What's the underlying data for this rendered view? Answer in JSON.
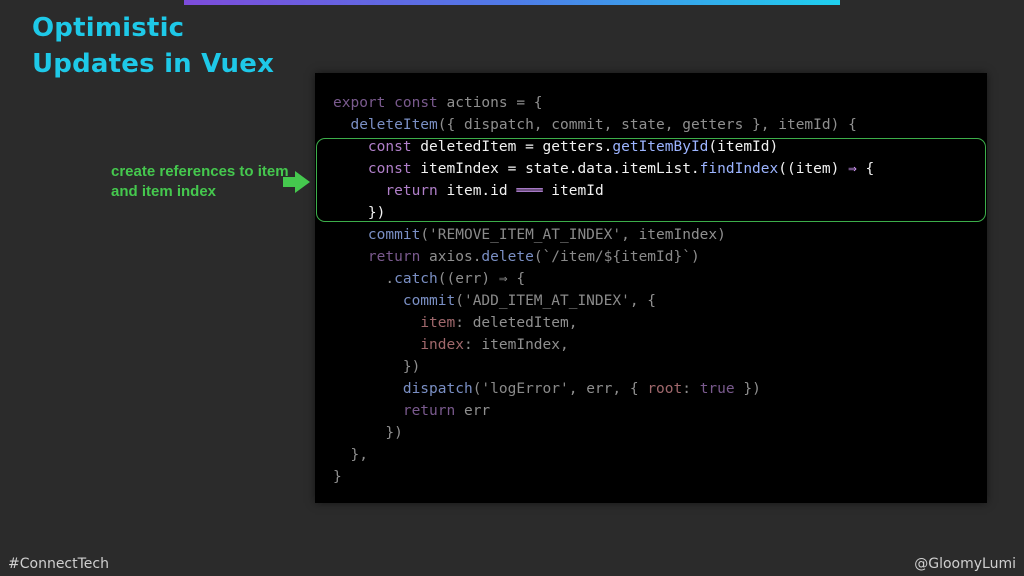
{
  "slide": {
    "title_line1": "Optimistic",
    "title_line2": "Updates in Vuex",
    "annotation": "create references to item and item index",
    "footer_left": "#ConnectTech",
    "footer_right": "@GloomyLumi"
  },
  "colors": {
    "background": "#2b2b2b",
    "title": "#1ec9e8",
    "annotation": "#45c84e",
    "highlight_border": "#3cae4a",
    "code_background": "#000000"
  },
  "icons": [
    "right-arrow-icon"
  ],
  "code": {
    "lines": [
      "export const actions = {",
      "  deleteItem({ dispatch, commit, state, getters }, itemId) {",
      "    const deletedItem = getters.getItemById(itemId)",
      "    const itemIndex = state.data.itemList.findIndex((item) ⇒ {",
      "      return item.id ═══ itemId",
      "    })",
      "    commit('REMOVE_ITEM_AT_INDEX', itemIndex)",
      "    return axios.delete(`/item/${itemId}`)",
      "      .catch((err) ⇒ {",
      "        commit('ADD_ITEM_AT_INDEX', {",
      "          item: deletedItem,",
      "          index: itemIndex,",
      "        })",
      "        dispatch('logError', err, { root: true })",
      "        return err",
      "      })",
      "  },",
      "}"
    ]
  }
}
